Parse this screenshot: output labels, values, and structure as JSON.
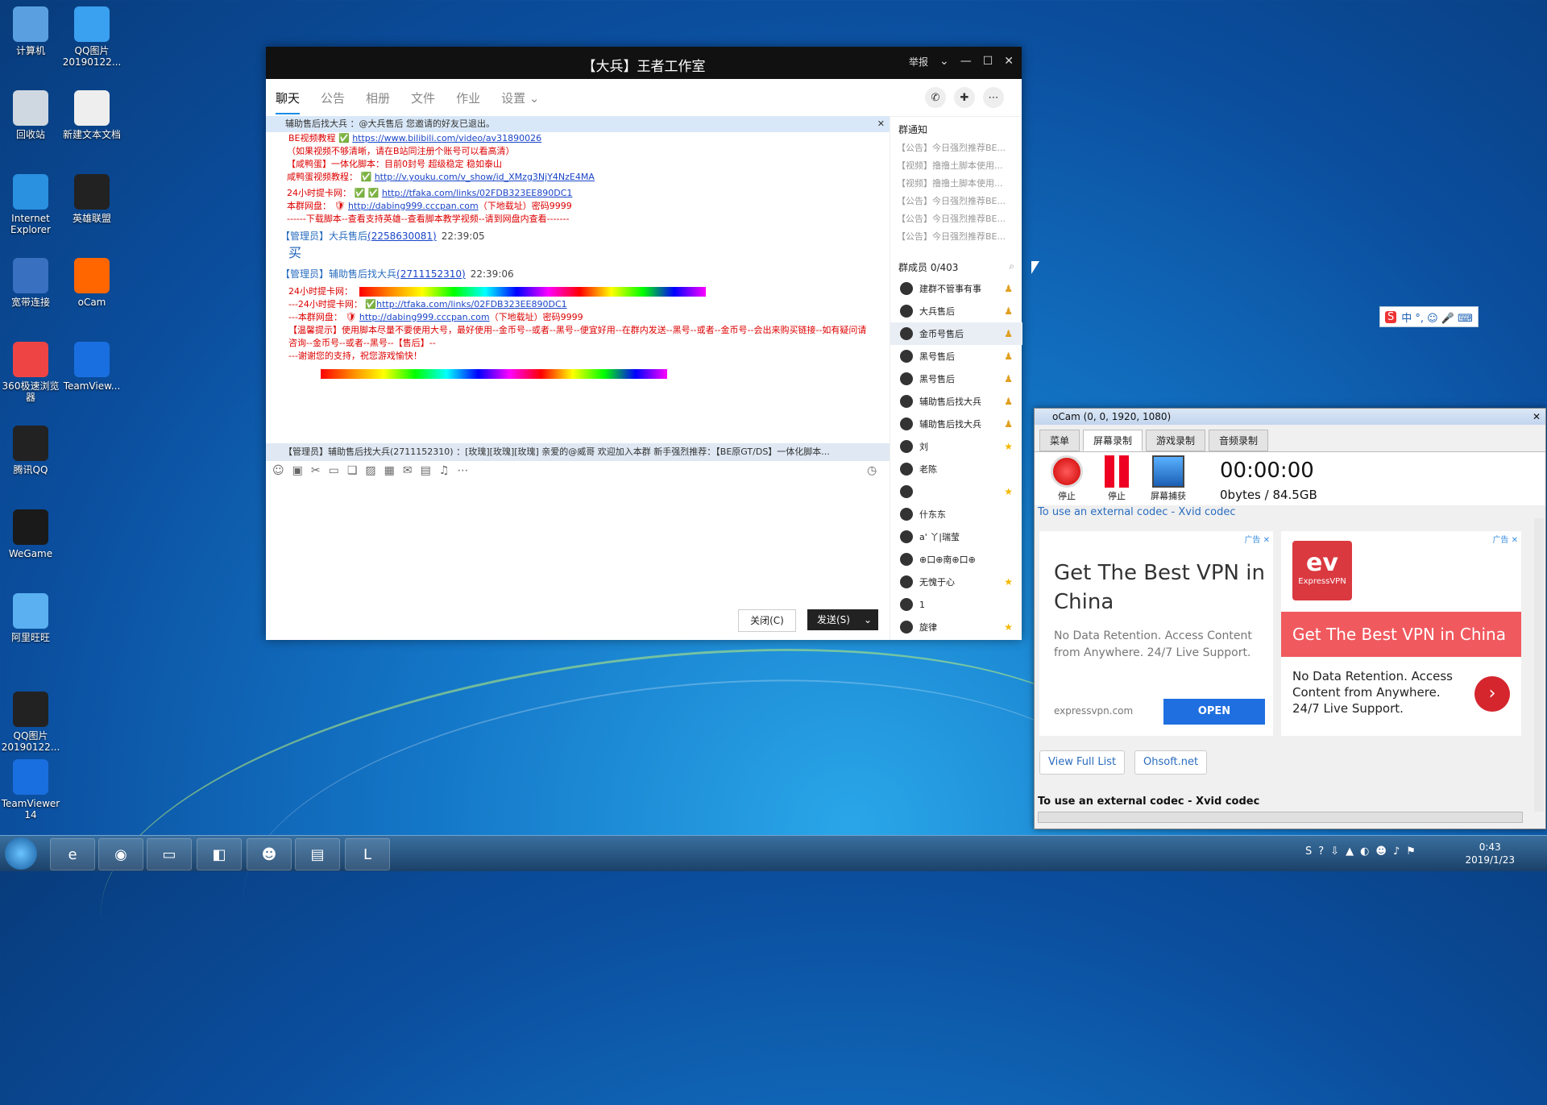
{
  "desktop": {
    "icons": [
      {
        "label": "计算机"
      },
      {
        "label": "QQ图片\n20190122..."
      },
      {
        "label": "回收站"
      },
      {
        "label": "新建文本文档"
      },
      {
        "label": "Internet\nExplorer"
      },
      {
        "label": "英雄联盟"
      },
      {
        "label": "宽带连接"
      },
      {
        "label": "oCam"
      },
      {
        "label": "360极速浏览\n器"
      },
      {
        "label": "TeamView..."
      },
      {
        "label": "腾讯QQ"
      },
      {
        "label": "WeGame"
      },
      {
        "label": "阿里旺旺"
      },
      {
        "label": "QQ图片\n20190122..."
      },
      {
        "label": "TeamViewer\n14"
      }
    ]
  },
  "qq": {
    "title": "【大兵】王者工作室",
    "report": "举报",
    "tabs": [
      "聊天",
      "公告",
      "相册",
      "文件",
      "作业",
      "设置"
    ],
    "notice_bar": "辅助售后找大兵 ：@大兵售后 您邀请的好友已退出。",
    "messages": {
      "m1_prefix": "BE视频教程",
      "m1_link": "https://www.bilibili.com/video/av31890026",
      "m2": "（如果视频不够清晰，请在B站同注册个账号可以看高清）",
      "m3": "【咸鸭蛋】一体化脚本：目前0封号 超级稳定 稳如泰山",
      "m4_prefix": "咸鸭蛋视频教程：",
      "m4_link": "http://v.youku.com/v_show/id_XMzg3NjY4NzE4MA",
      "m5_prefix": "24小时提卡网：",
      "m5_link": "http://tfaka.com/links/02FDB323EE890DC1",
      "m6_prefix": "本群网盘：",
      "m6_link": "http://dabing999.cccpan.com",
      "m6_suffix": "（下地载址）密码9999",
      "m7": "------下载脚本--查看支持英雄--查看脚本教学视频--请到网盘内查看-------",
      "mgr1_name": "【管理员】大兵售后",
      "mgr1_id": "(2258630081)",
      "mgr1_time": "22:39:05",
      "buy": "买",
      "mgr2_name": "【管理员】辅助售后找大兵",
      "mgr2_id": "(2711152310)",
      "mgr2_time": "22:39:06",
      "n1": "24小时提卡网：",
      "n2_prefix": "---24小时提卡网：",
      "n2_link": "http://tfaka.com/links/02FDB323EE890DC1",
      "n3_prefix": "---本群网盘：",
      "n3_link": "http://dabing999.cccpan.com",
      "n3_suffix": "（下地载址）密码9999",
      "n4": "【温馨提示】使用脚本尽量不要使用大号，最好使用--金币号--或者--黑号--便宜好用--在群内发送--黑号--或者--金币号--会出来购买链接--如有疑问请咨询--金币号--或者--黑号--【售后】--",
      "n5": "---谢谢您的支持，祝您游戏愉快！"
    },
    "bottom_notice": "【管理员】辅助售后找大兵(2711152310) ：[玫瑰][玫瑰][玫瑰] 亲爱的@威哥 欢迎加入本群 新手强烈推荐：【BE原GT/DS】一体化脚本...",
    "close_btn": "关闭(C)",
    "send_btn": "发送(S)",
    "sidebar": {
      "notice_title": "群通知",
      "notices": [
        "【公告】今日强烈推荐BE...",
        "【视频】撸撸土脚本使用...",
        "【视频】撸撸土脚本使用...",
        "【公告】今日强烈推荐BE...",
        "【公告】今日强烈推荐BE...",
        "【公告】今日强烈推荐BE..."
      ],
      "members_title": "群成员 0/403",
      "members": [
        {
          "name": "建群不管事有事",
          "badge": "admin"
        },
        {
          "name": "大兵售后",
          "badge": "admin"
        },
        {
          "name": "金币号售后",
          "badge": "admin"
        },
        {
          "name": "黑号售后",
          "badge": "admin"
        },
        {
          "name": "黑号售后",
          "badge": "admin"
        },
        {
          "name": "辅助售后找大兵",
          "badge": "admin"
        },
        {
          "name": "辅助售后找大兵",
          "badge": "admin"
        },
        {
          "name": "刘",
          "badge": "star"
        },
        {
          "name": "老陈",
          "badge": ""
        },
        {
          "name": "",
          "badge": "star"
        },
        {
          "name": "什东东",
          "badge": ""
        },
        {
          "name": "a' 丫|瑞莹",
          "badge": ""
        },
        {
          "name": "⊕口⊕南⊕口⊕",
          "badge": ""
        },
        {
          "name": "无愧于心",
          "badge": "star"
        },
        {
          "name": "1",
          "badge": ""
        },
        {
          "name": "旋律",
          "badge": "star"
        }
      ]
    }
  },
  "ocam": {
    "title": "oCam (0, 0, 1920, 1080)",
    "tabs": [
      "菜单",
      "屏幕录制",
      "游戏录制",
      "音频录制"
    ],
    "btn_stop1": "停止",
    "btn_stop2": "停止",
    "btn_capture": "屏幕捕获",
    "timer": "00:00:00",
    "size": "0bytes / 84.5GB",
    "codec_link": "To use an external codec - Xvid codec",
    "ad_left_headline": "Get The Best VPN in China",
    "ad_left_body": "No Data Retention. Access Content from Anywhere. 24/7 Live Support.",
    "ad_domain": "expressvpn.com",
    "ad_open": "OPEN",
    "ad_right_logo": "ExpressVPN",
    "ad_right_headline": "Get The Best VPN in China",
    "ad_right_body": "No Data Retention. Access Content from Anywhere. 24/7 Live Support.",
    "ad_tag": "广告 ✕",
    "view_full": "View Full List",
    "ohsoft": "Ohsoft.net",
    "codec_bold": "To use an external codec - Xvid codec"
  },
  "taskbar": {
    "time": "0:43",
    "date": "2019/1/23"
  },
  "ime": {
    "text": "中 °, ☺ 🎤 ⌨"
  }
}
